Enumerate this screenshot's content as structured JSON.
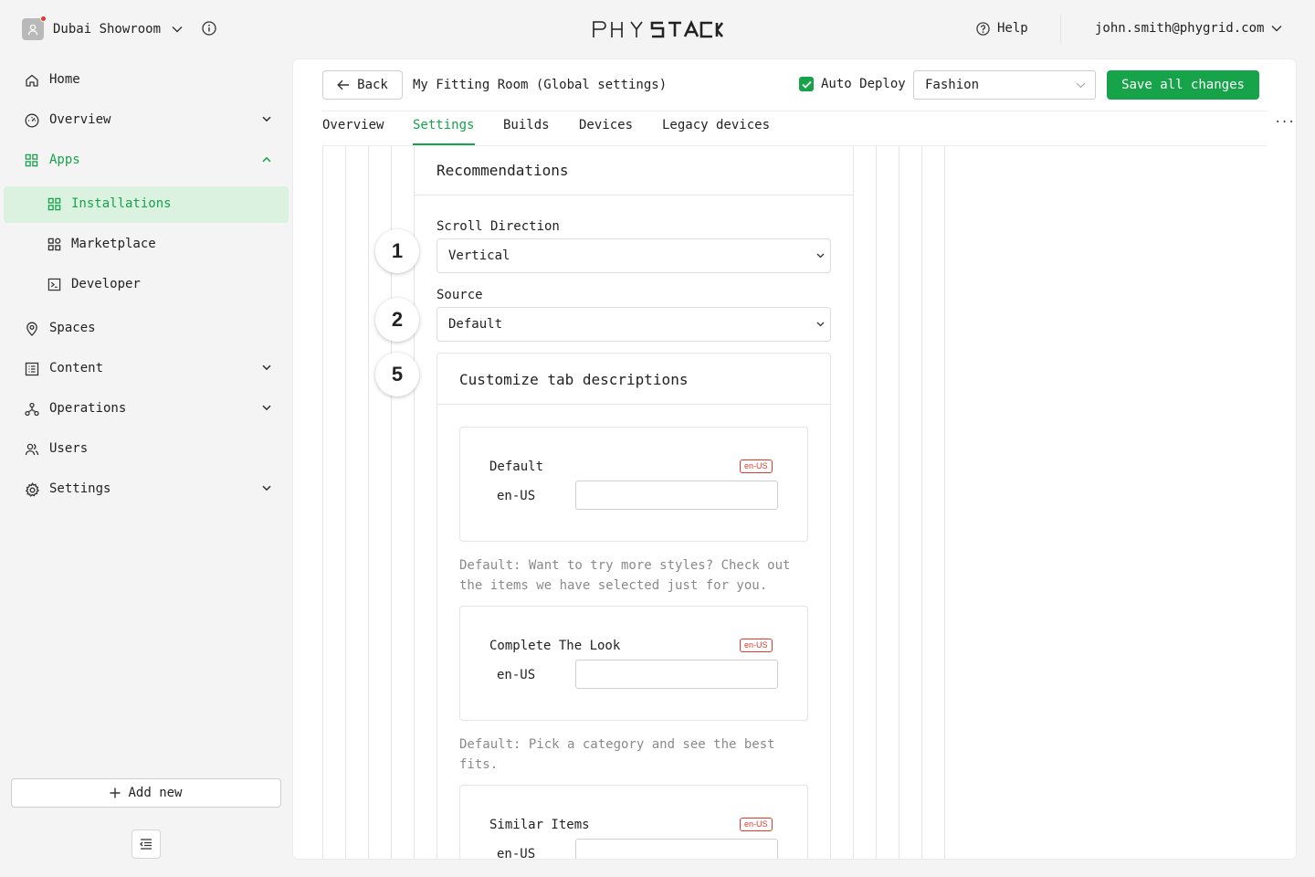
{
  "org": {
    "name": "Dubai Showroom"
  },
  "brand": {
    "logo_text": "PHYSTACK",
    "accent": "#16a34a",
    "alert": "#e5382c"
  },
  "header": {
    "help_label": "Help",
    "user_email": "john.smith@phygrid.com"
  },
  "sidebar": {
    "items": [
      {
        "label": "Home",
        "icon": "home-icon"
      },
      {
        "label": "Overview",
        "icon": "gauge-icon"
      },
      {
        "label": "Apps",
        "icon": "apps-grid-icon"
      },
      {
        "label": "Installations",
        "icon": "apps-grid-icon"
      },
      {
        "label": "Marketplace",
        "icon": "marketplace-icon"
      },
      {
        "label": "Developer",
        "icon": "terminal-icon"
      },
      {
        "label": "Spaces",
        "icon": "location-pin-icon"
      },
      {
        "label": "Content",
        "icon": "content-icon"
      },
      {
        "label": "Operations",
        "icon": "operations-icon"
      },
      {
        "label": "Users",
        "icon": "users-icon"
      },
      {
        "label": "Settings",
        "icon": "gear-icon"
      }
    ],
    "add_new_label": "Add new"
  },
  "toolbar": {
    "back_label": "Back",
    "title": "My Fitting Room (Global settings)",
    "auto_deploy_label": "Auto Deploy",
    "auto_deploy_checked": true,
    "profile_value": "Fashion",
    "save_label": "Save all changes"
  },
  "tabs": [
    {
      "label": "Overview"
    },
    {
      "label": "Settings",
      "active": true
    },
    {
      "label": "Builds"
    },
    {
      "label": "Devices"
    },
    {
      "label": "Legacy devices"
    }
  ],
  "more_label": "···",
  "recommendations": {
    "title": "Recommendations",
    "scroll_direction_label": "Scroll Direction",
    "scroll_direction_value": "Vertical",
    "source_label": "Source",
    "source_value": "Default",
    "badges": [
      "1",
      "2",
      "5"
    ],
    "tab_descriptions": {
      "title": "Customize tab descriptions",
      "items": [
        {
          "name": "Default",
          "locale_badge": "en-US",
          "locale": "en-US",
          "value": "",
          "help": "Default: Want to try more styles? Check out the items we have selected just for you."
        },
        {
          "name": "Complete The Look",
          "locale_badge": "en-US",
          "locale": "en-US",
          "value": "",
          "help": "Default: Pick a category and see the best fits."
        },
        {
          "name": "Similar Items",
          "locale_badge": "en-US",
          "locale": "en-US",
          "value": ""
        }
      ]
    }
  }
}
